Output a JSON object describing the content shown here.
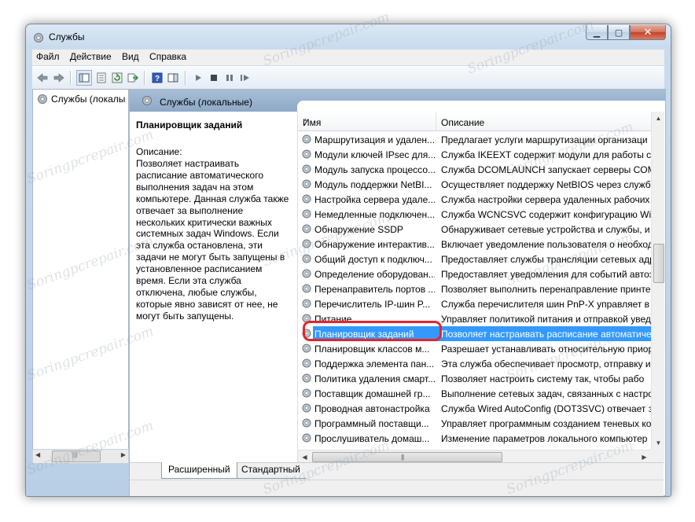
{
  "window": {
    "title": "Службы"
  },
  "menu": [
    "Файл",
    "Действие",
    "Вид",
    "Справка"
  ],
  "nav": {
    "tree_item": "Службы (локалы"
  },
  "main": {
    "header": "Службы (локальные)",
    "detail_title": "Планировщик заданий",
    "detail_label": "Описание:",
    "detail_text": "Позволяет настраивать расписание автоматического выполнения задач на этом компьютере. Данная служба также отвечает за выполнение нескольких критически важных системных задач Windows. Если эта служба остановлена, эти задачи не могут быть запущены в установленное расписанием время. Если эта служба отключена, любые службы, которые явно зависят от нее, не могут быть запущены."
  },
  "columns": {
    "name": "Имя",
    "description": "Описание"
  },
  "rows": [
    {
      "name": "Маршрутизация и удален...",
      "description": "Предлагает услуги маршрутизации организаци"
    },
    {
      "name": "Модули ключей IPsec для...",
      "description": "Служба IKEEXT содержит модули для работы с к"
    },
    {
      "name": "Модуль запуска процессо...",
      "description": "Служба DCOMLAUNCH запускает серверы COM"
    },
    {
      "name": "Модуль поддержки NetBI...",
      "description": "Осуществляет поддержку NetBIOS через служб"
    },
    {
      "name": "Настройка сервера удале...",
      "description": "Служба настройки сервера удаленных рабочих"
    },
    {
      "name": "Немедленные подключен...",
      "description": "Служба WCNCSVC содержит конфигурацию Wi"
    },
    {
      "name": "Обнаружение SSDP",
      "description": "Обнаруживает сетевые устройства и службы, и"
    },
    {
      "name": "Обнаружение интерактив...",
      "description": "Включает уведомление пользователя о необход"
    },
    {
      "name": "Общий доступ к подключ...",
      "description": "Предоставляет службы трансляции сетевых адр"
    },
    {
      "name": "Определение оборудован...",
      "description": "Предоставляет уведомления для событий автоз"
    },
    {
      "name": "Перенаправитель портов ...",
      "description": "Позволяет выполнить перенаправление принте"
    },
    {
      "name": "Перечислитель IP-шин P...",
      "description": "Служба перечислителя шин PnP-X управляет в"
    },
    {
      "name": "Питание",
      "description": "Управляет политикой питания и отправкой увед"
    },
    {
      "name": "Планировщик заданий",
      "description": "Позволяет настраивать расписание автоматиче",
      "selected": true
    },
    {
      "name": "Планировщик классов м...",
      "description": "Разрешает устанавливать относительную приор"
    },
    {
      "name": "Поддержка элемента пан...",
      "description": "Эта служба обеспечивает просмотр, отправку и"
    },
    {
      "name": "Политика удаления смарт...",
      "description": "Позволяет настроить систему так, чтобы рабо"
    },
    {
      "name": "Поставщик домашней гр...",
      "description": "Выполнение сетевых задач, связанных с настро"
    },
    {
      "name": "Проводная автонастройка",
      "description": "Служба Wired AutoConfig (DOT3SVC) отвечает з"
    },
    {
      "name": "Программный поставщи...",
      "description": "Управляет программным созданием теневых ко"
    },
    {
      "name": "Прослушиватель домаш...",
      "description": "Изменение параметров локального компьютер"
    }
  ],
  "tabs": {
    "extended": "Расширенный",
    "standard": "Стандартный"
  },
  "watermark": "Soringpcrepair.com",
  "colors": {
    "selection": "#3399ff",
    "highlight_ring": "#e8232a",
    "header_band": "#9bb4cf"
  }
}
